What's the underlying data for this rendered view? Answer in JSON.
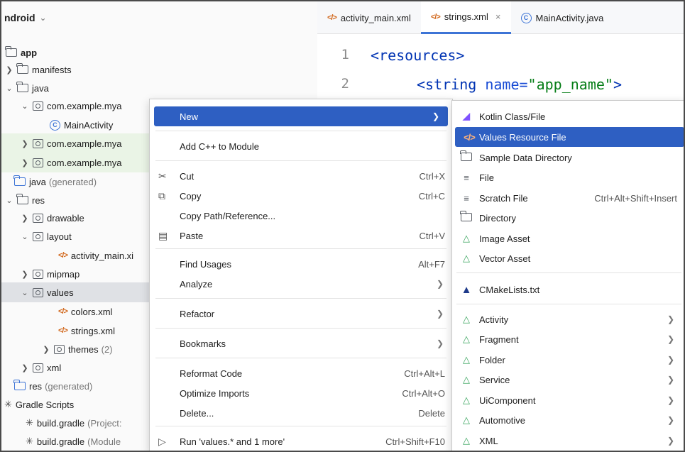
{
  "project_panel": {
    "view_selector": "ndroid",
    "tree": [
      {
        "label": "app",
        "bold": true,
        "icon": "module-folder-icon",
        "arrow": ""
      },
      {
        "label": "manifests",
        "icon": "folder-icon",
        "arrow": ">"
      },
      {
        "label": "java",
        "icon": "folder-icon",
        "arrow": "v"
      },
      {
        "label": "com.example.mya",
        "icon": "package-icon",
        "arrow": "v"
      },
      {
        "label": "MainActivity",
        "icon": "class-icon",
        "arrow": ""
      },
      {
        "label": "com.example.mya",
        "icon": "package-icon",
        "arrow": ">"
      },
      {
        "label": "com.example.mya",
        "icon": "package-icon",
        "arrow": ">"
      },
      {
        "label": "java",
        "suffix": "(generated)",
        "icon": "generated-folder-icon",
        "arrow": ""
      },
      {
        "label": "res",
        "icon": "res-folder-icon",
        "arrow": "v"
      },
      {
        "label": "drawable",
        "icon": "package-icon",
        "arrow": ">"
      },
      {
        "label": "layout",
        "icon": "package-icon",
        "arrow": "v"
      },
      {
        "label": "activity_main.xi",
        "icon": "xml-file-icon",
        "arrow": ""
      },
      {
        "label": "mipmap",
        "icon": "package-icon",
        "arrow": ">"
      },
      {
        "label": "values",
        "icon": "package-icon",
        "arrow": "v"
      },
      {
        "label": "colors.xml",
        "icon": "xml-file-icon",
        "arrow": ""
      },
      {
        "label": "strings.xml",
        "icon": "xml-file-icon",
        "arrow": ""
      },
      {
        "label": "themes",
        "suffix": "(2)",
        "icon": "package-icon",
        "arrow": ">"
      },
      {
        "label": "xml",
        "icon": "package-icon",
        "arrow": ">"
      },
      {
        "label": "res",
        "suffix": "(generated)",
        "icon": "generated-folder-icon",
        "arrow": ""
      },
      {
        "label": "Gradle Scripts",
        "icon": "gradle-icon",
        "arrow": ""
      },
      {
        "label": "build.gradle",
        "suffix": "(Project:",
        "icon": "gradle-icon",
        "arrow": ""
      },
      {
        "label": "build.gradle",
        "suffix": "(Module",
        "icon": "gradle-icon",
        "arrow": ""
      }
    ]
  },
  "editor": {
    "tabs": [
      {
        "label": "activity_main.xml",
        "icon": "xml-file-icon",
        "active": false
      },
      {
        "label": "strings.xml",
        "icon": "xml-file-icon",
        "active": true,
        "close": "×"
      },
      {
        "label": "MainActivity.java",
        "icon": "class-icon",
        "active": false
      }
    ],
    "line_numbers": [
      "1",
      "2"
    ],
    "code": {
      "line1": "<resources>",
      "line2_tag": "<string",
      "line2_attr": " name=",
      "line2_val": "\"app_name\"",
      "line2_end": ">"
    }
  },
  "context_menu": {
    "items": [
      {
        "label": "New",
        "shortcut": "",
        "submenu": true,
        "highlighted": true
      },
      {
        "label": "Add C++ to Module",
        "shortcut": ""
      },
      {
        "label": "Cut",
        "shortcut": "Ctrl+X",
        "icon": "scissors-icon"
      },
      {
        "label": "Copy",
        "shortcut": "Ctrl+C",
        "icon": "copy-icon"
      },
      {
        "label": "Copy Path/Reference...",
        "shortcut": ""
      },
      {
        "label": "Paste",
        "shortcut": "Ctrl+V",
        "icon": "paste-icon"
      },
      {
        "label": "Find Usages",
        "shortcut": "Alt+F7"
      },
      {
        "label": "Analyze",
        "submenu": true
      },
      {
        "label": "Refactor",
        "submenu": true
      },
      {
        "label": "Bookmarks",
        "submenu": true
      },
      {
        "label": "Reformat Code",
        "shortcut": "Ctrl+Alt+L"
      },
      {
        "label": "Optimize Imports",
        "shortcut": "Ctrl+Alt+O"
      },
      {
        "label": "Delete...",
        "shortcut": "Delete"
      },
      {
        "label": "Run 'values.* and 1 more'",
        "shortcut": "Ctrl+Shift+F10",
        "icon": "run-icon"
      }
    ]
  },
  "new_submenu": {
    "items": [
      {
        "label": "Kotlin Class/File",
        "icon": "kotlin-icon"
      },
      {
        "label": "Values Resource File",
        "icon": "xml-file-icon",
        "highlighted": true
      },
      {
        "label": "Sample Data Directory",
        "icon": "folder-icon"
      },
      {
        "label": "File",
        "icon": "file-icon"
      },
      {
        "label": "Scratch File",
        "icon": "scratch-file-icon",
        "shortcut": "Ctrl+Alt+Shift+Insert"
      },
      {
        "label": "Directory",
        "icon": "folder-icon"
      },
      {
        "label": "Image Asset",
        "icon": "android-icon"
      },
      {
        "label": "Vector Asset",
        "icon": "android-icon"
      },
      {
        "label": "CMakeLists.txt",
        "icon": "cmake-icon"
      },
      {
        "label": "Activity",
        "icon": "android-icon",
        "submenu": true
      },
      {
        "label": "Fragment",
        "icon": "android-icon",
        "submenu": true
      },
      {
        "label": "Folder",
        "icon": "android-icon",
        "submenu": true
      },
      {
        "label": "Service",
        "icon": "android-icon",
        "submenu": true
      },
      {
        "label": "UiComponent",
        "icon": "android-icon",
        "submenu": true
      },
      {
        "label": "Automotive",
        "icon": "android-icon",
        "submenu": true
      },
      {
        "label": "XML",
        "icon": "android-icon",
        "submenu": true
      }
    ]
  }
}
